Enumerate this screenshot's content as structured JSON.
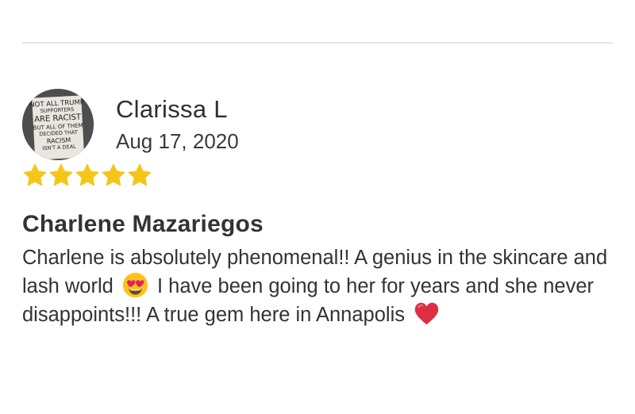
{
  "reviewer": {
    "name": "Clarissa L",
    "date": "Aug 17, 2020",
    "avatar_sign_lines": [
      "NOT ALL TRUMP",
      "SUPPORTERS",
      "ARE RACIST",
      "BUT ALL OF THEM",
      "DECIDED THAT",
      "RACISM",
      "ISN'T A DEAL"
    ]
  },
  "rating": {
    "stars": 5,
    "max": 5,
    "star_color": "#f5c518"
  },
  "review": {
    "title": "Charlene Mazariegos",
    "body_part1": "Charlene is absolutely phenomenal!! A genius in the skincare and lash world",
    "emoji1": "heart-eyes-emoji",
    "body_part2": "I have been going to her for years and she never disappoints!!! A true gem here in Annapolis",
    "emoji2": "red-heart-emoji"
  }
}
